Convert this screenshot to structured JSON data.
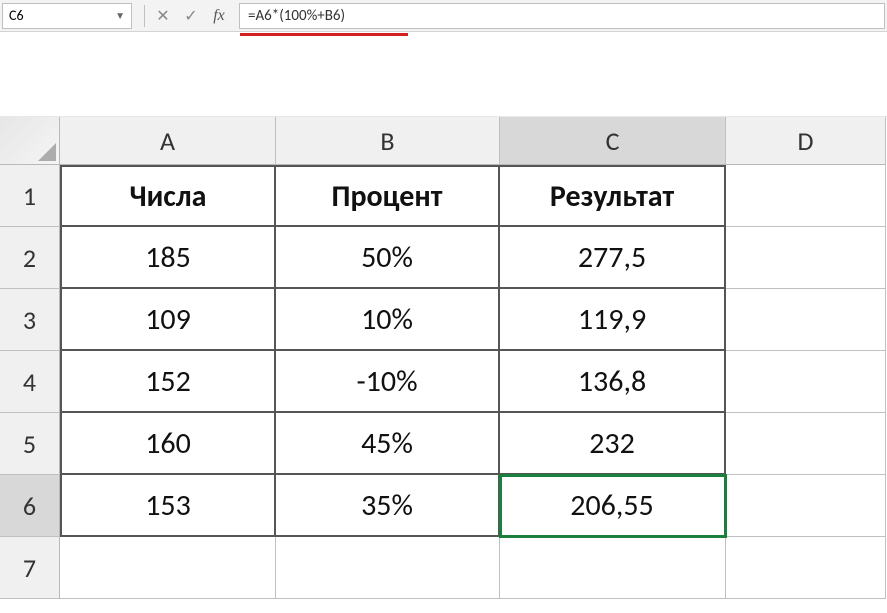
{
  "nameBox": "C6",
  "formula": "=A6*(100%+B6)",
  "columns": [
    "A",
    "B",
    "C",
    "D"
  ],
  "rows": [
    "1",
    "2",
    "3",
    "4",
    "5",
    "6",
    "7"
  ],
  "headers": {
    "a": "Числа",
    "b": "Процент",
    "c": "Результат"
  },
  "data": [
    {
      "a": "185",
      "b": "50%",
      "c": "277,5"
    },
    {
      "a": "109",
      "b": "10%",
      "c": "119,9"
    },
    {
      "a": "152",
      "b": "-10%",
      "c": "136,8"
    },
    {
      "a": "160",
      "b": "45%",
      "c": "232"
    },
    {
      "a": "153",
      "b": "35%",
      "c": "206,55"
    }
  ],
  "activeCell": "C6",
  "fxLabel": "fx"
}
